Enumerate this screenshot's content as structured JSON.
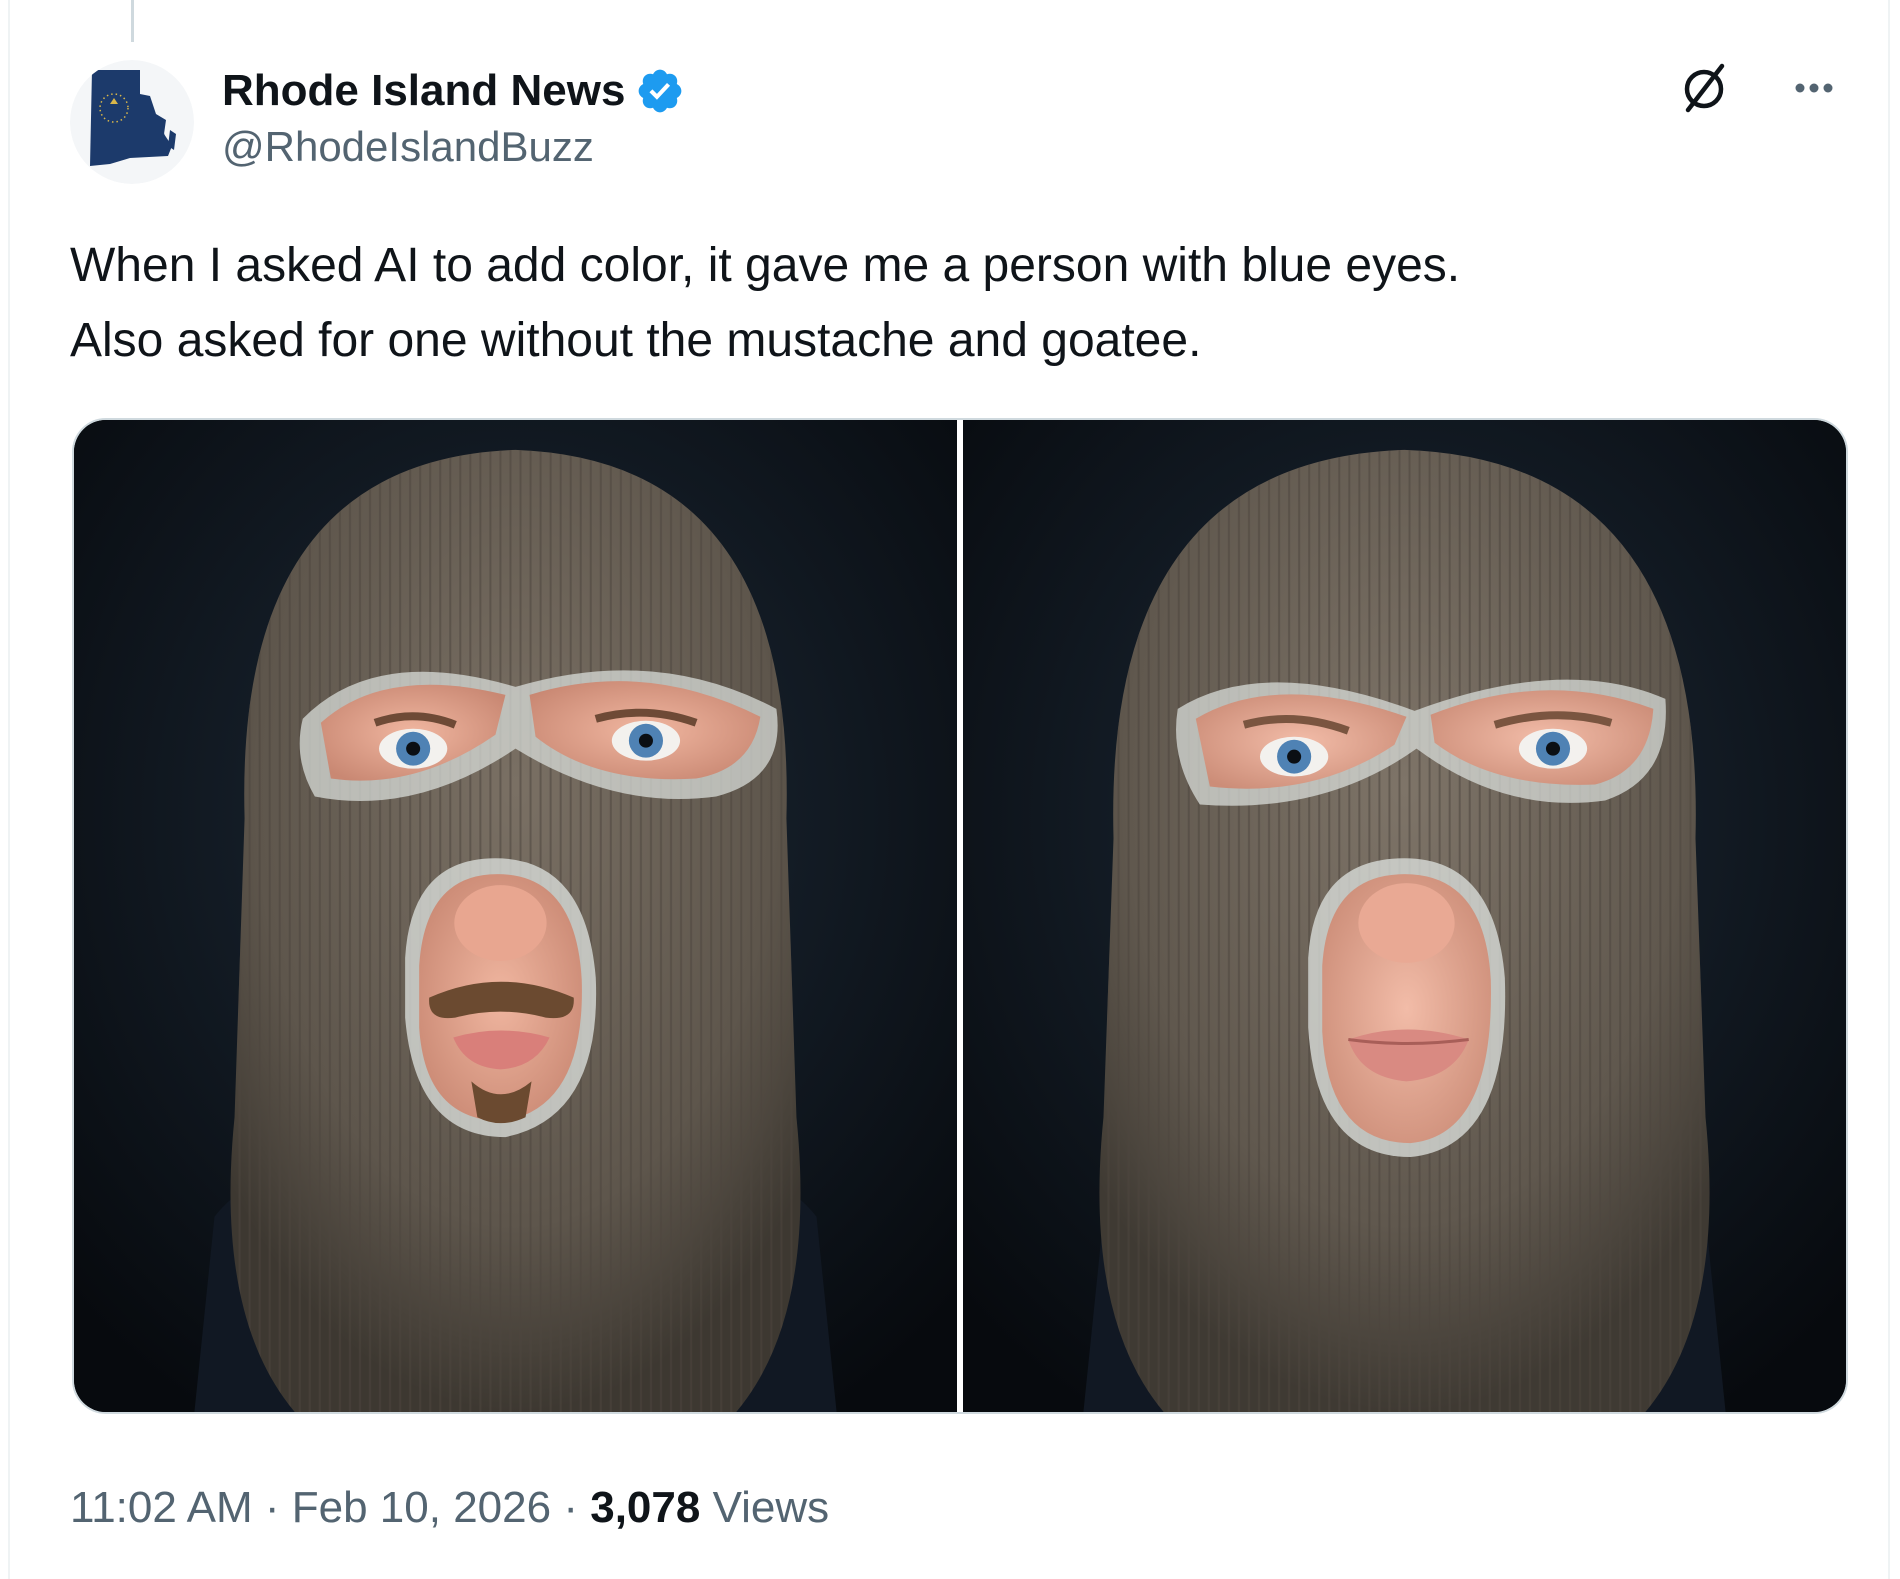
{
  "tweet": {
    "author": {
      "display_name": "Rhode Island News",
      "handle": "@RhodeIslandBuzz",
      "verified": true,
      "avatar_icon": "rhode-island-map-icon",
      "avatar_color": "#1c3a6b"
    },
    "text_lines": [
      "When I asked AI to add color, it gave me a person with blue eyes.",
      "Also asked for one without the mustache and goatee."
    ],
    "media": [
      {
        "subject": "balaclava-person-with-mustache-goatee"
      },
      {
        "subject": "balaclava-person-clean-shaven"
      }
    ],
    "meta": {
      "time": "11:02 AM",
      "separator": "·",
      "date": "Feb 10, 2026",
      "views_count": "3,078",
      "views_label": "Views"
    },
    "actions": {
      "grok_icon": "grok-slash-icon",
      "more_icon": "more-dots-icon"
    },
    "colors": {
      "verified_blue": "#1d9bf0",
      "text": "#0f1419",
      "muted": "#536471"
    }
  }
}
